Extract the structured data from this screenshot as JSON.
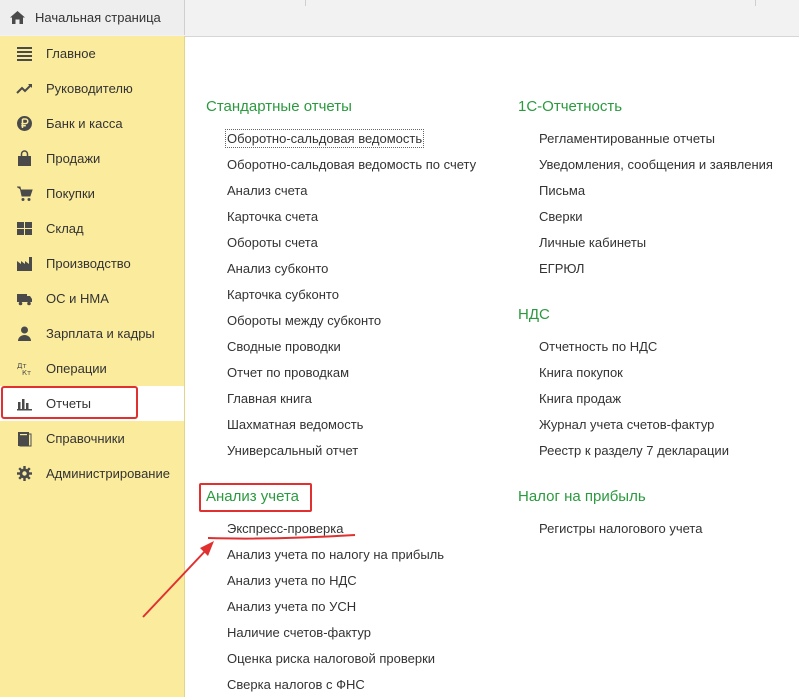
{
  "top": {
    "home_tab": "Начальная страница"
  },
  "sidebar": {
    "items": [
      {
        "label": "Главное",
        "icon": "menu-lines-icon"
      },
      {
        "label": "Руководителю",
        "icon": "trend-chart-icon"
      },
      {
        "label": "Банк и касса",
        "icon": "ruble-coin-icon"
      },
      {
        "label": "Продажи",
        "icon": "shopping-bag-icon"
      },
      {
        "label": "Покупки",
        "icon": "shopping-cart-icon"
      },
      {
        "label": "Склад",
        "icon": "warehouse-grid-icon"
      },
      {
        "label": "Производство",
        "icon": "factory-icon"
      },
      {
        "label": "ОС и НМА",
        "icon": "truck-icon"
      },
      {
        "label": "Зарплата и кадры",
        "icon": "person-icon"
      },
      {
        "label": "Операции",
        "icon": "dt-kt-icon"
      },
      {
        "label": "Отчеты",
        "icon": "bar-chart-icon",
        "active": true
      },
      {
        "label": "Справочники",
        "icon": "book-icon"
      },
      {
        "label": "Администрирование",
        "icon": "gear-icon"
      }
    ]
  },
  "main": {
    "standard": {
      "title": "Стандартные отчеты",
      "items": [
        "Оборотно-сальдовая ведомость",
        "Оборотно-сальдовая ведомость по счету",
        "Анализ счета",
        "Карточка счета",
        "Обороты счета",
        "Анализ субконто",
        "Карточка субконто",
        "Обороты между субконто",
        "Сводные проводки",
        "Отчет по проводкам",
        "Главная книга",
        "Шахматная ведомость",
        "Универсальный отчет"
      ]
    },
    "analysis": {
      "title": "Анализ учета",
      "items": [
        "Экспресс-проверка",
        "Анализ учета по налогу на прибыль",
        "Анализ учета по НДС",
        "Анализ учета по УСН",
        "Наличие счетов-фактур",
        "Оценка риска налоговой проверки",
        "Сверка налогов с ФНС"
      ]
    },
    "reporting": {
      "title": "1С-Отчетность",
      "items": [
        "Регламентированные отчеты",
        "Уведомления, сообщения и заявления",
        "Письма",
        "Сверки",
        "Личные кабинеты",
        "ЕГРЮЛ"
      ]
    },
    "vat": {
      "title": "НДС",
      "items": [
        "Отчетность по НДС",
        "Книга покупок",
        "Книга продаж",
        "Журнал учета счетов-фактур",
        "Реестр к разделу 7 декларации"
      ]
    },
    "profit": {
      "title": "Налог на прибыль",
      "items": [
        "Регистры налогового учета"
      ]
    }
  },
  "colors": {
    "sidebar_bg": "#fbeb9d",
    "group_title": "#2b9a3f",
    "annotation": "#e03030"
  }
}
